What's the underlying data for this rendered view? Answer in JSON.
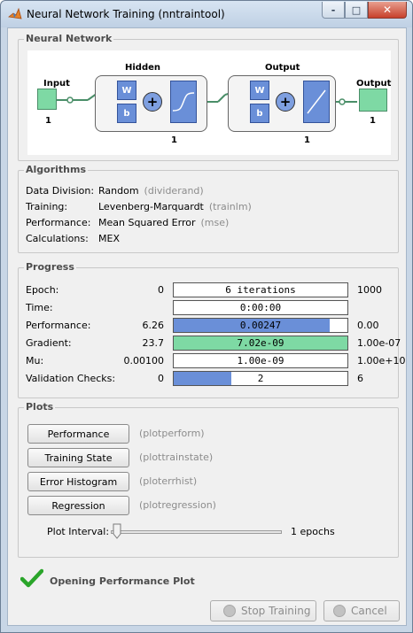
{
  "window": {
    "title": "Neural Network Training (nntraintool)",
    "controls": {
      "minimize": "-",
      "maximize": "□",
      "close": "✕"
    }
  },
  "network": {
    "title": "Neural Network",
    "input": {
      "label": "Input",
      "size": "1"
    },
    "hidden": {
      "label": "Hidden",
      "size": "1",
      "w": "W",
      "b": "b"
    },
    "output_layer": {
      "label": "Output",
      "size": "1",
      "w": "W",
      "b": "b"
    },
    "output": {
      "label": "Output",
      "size": "1"
    },
    "sum_symbol": "+",
    "colors": {
      "io": "#7ed9a4",
      "weight": "#6a8fd8"
    }
  },
  "algorithms": {
    "title": "Algorithms",
    "rows": [
      {
        "key": "Data Division:",
        "value": "Random",
        "fn": "(dividerand)"
      },
      {
        "key": "Training:",
        "value": "Levenberg-Marquardt",
        "fn": "(trainlm)"
      },
      {
        "key": "Performance:",
        "value": "Mean Squared Error",
        "fn": "(mse)"
      },
      {
        "key": "Calculations:",
        "value": "MEX",
        "fn": ""
      }
    ]
  },
  "progress": {
    "title": "Progress",
    "rows": [
      {
        "label": "Epoch:",
        "start": "0",
        "bar_text": "6 iterations",
        "end": "1000",
        "fill": 0.0,
        "fill_color": "#6a8fd8"
      },
      {
        "label": "Time:",
        "start": "",
        "bar_text": "0:00:00",
        "end": "",
        "fill": 0.0,
        "fill_color": "#6a8fd8"
      },
      {
        "label": "Performance:",
        "start": "6.26",
        "bar_text": "0.00247",
        "end": "0.00",
        "fill": 0.9,
        "fill_color": "#6a8fd8"
      },
      {
        "label": "Gradient:",
        "start": "23.7",
        "bar_text": "7.02e-09",
        "end": "1.00e-07",
        "fill": 1.0,
        "fill_color": "#7ed9a4"
      },
      {
        "label": "Mu:",
        "start": "0.00100",
        "bar_text": "1.00e-09",
        "end": "1.00e+10",
        "fill": 0.0,
        "fill_color": "#6a8fd8"
      },
      {
        "label": "Validation Checks:",
        "start": "0",
        "bar_text": "2",
        "end": "6",
        "fill": 0.333,
        "fill_color": "#6a8fd8"
      }
    ]
  },
  "plots": {
    "title": "Plots",
    "buttons": [
      {
        "label": "Performance",
        "fn": "(plotperform)"
      },
      {
        "label": "Training State",
        "fn": "(plottrainstate)"
      },
      {
        "label": "Error Histogram",
        "fn": "(ploterrhist)"
      },
      {
        "label": "Regression",
        "fn": "(plotregression)"
      }
    ],
    "interval_label": "Plot Interval:",
    "interval_value": "1 epochs",
    "interval_slider": 0.0
  },
  "status": {
    "icon": "checkmark-icon",
    "text": "Opening Performance Plot",
    "color": "#2aa52a"
  },
  "footer": {
    "stop_label": "Stop Training",
    "cancel_label": "Cancel"
  }
}
